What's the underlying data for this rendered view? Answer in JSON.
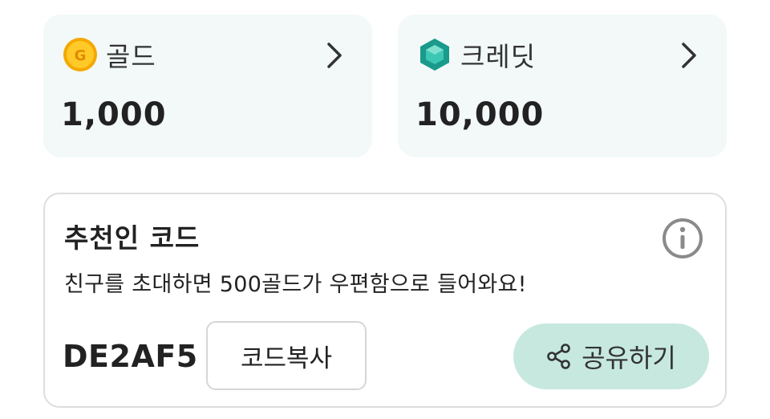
{
  "balances": {
    "gold": {
      "label": "골드",
      "value": "1,000",
      "icon": "gold-coin-icon"
    },
    "credit": {
      "label": "크레딧",
      "value": "10,000",
      "icon": "credit-gem-icon"
    }
  },
  "referral": {
    "title": "추천인 코드",
    "description": "친구를 초대하면 500골드가 우편함으로 들어와요!",
    "code": "DE2AF5",
    "copy_label": "코드복사",
    "share_label": "공유하기"
  },
  "colors": {
    "card_bg": "#f2f9f8",
    "share_bg": "#c6e8df",
    "gold": "#f5b800",
    "gem": "#1fa99a"
  }
}
